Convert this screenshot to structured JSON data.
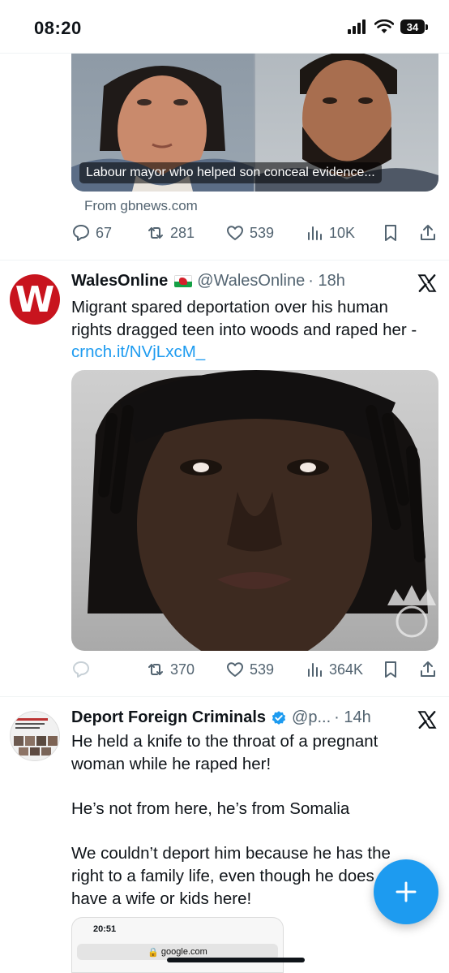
{
  "status_bar": {
    "time": "08:20",
    "battery": "34",
    "icons": [
      "signal-icon",
      "wifi-icon",
      "battery-icon"
    ]
  },
  "tweet_top": {
    "media_caption": "Labour mayor who helped son conceal evidence...",
    "source": "From gbnews.com",
    "replies": "67",
    "reposts": "281",
    "likes": "539",
    "views": "10K"
  },
  "tweet_wales": {
    "avatar_letter": "W",
    "display_name": "WalesOnline",
    "handle": "@WalesOnline",
    "time": "· 18h",
    "text_line1": "Migrant spared deportation over his human",
    "text_line2": "rights dragged teen into woods and raped her -",
    "link": "crnch.it/NVjLxcM_",
    "reposts": "370",
    "likes": "539",
    "views": "364K"
  },
  "tweet_dfc": {
    "display_name": "Deport Foreign Criminals",
    "handle": "@p...",
    "time": "· 14h",
    "para1_line1": "He held a knife to the throat of a pregnant",
    "para1_line2": "woman while he raped her!",
    "para2": "He’s not from here, he’s from Somalia",
    "para3_line1": "We couldn’t deport him because he has the",
    "para3_line2": "right to a family life, even though he does",
    "para3_line3": "have a wife or kids here!",
    "embed_time": "20:51",
    "embed_url": "google.com"
  },
  "colors": {
    "accent": "#1d9bf0",
    "text_secondary": "#536471",
    "wales_red": "#c8141e"
  }
}
